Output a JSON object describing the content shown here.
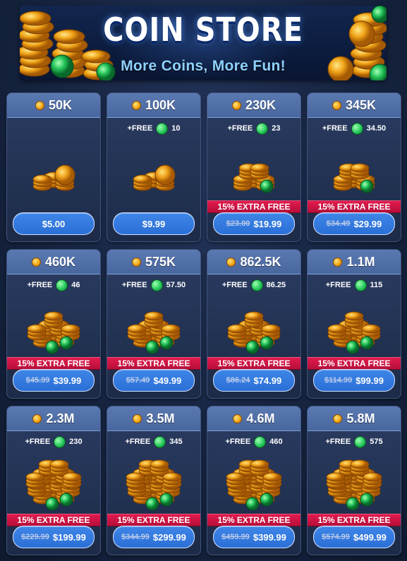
{
  "banner": {
    "title": "COIN STORE",
    "subtitle": "More Coins, More Fun!"
  },
  "free_label": "+FREE",
  "ribbon_text": "15% EXTRA FREE",
  "colors": {
    "background": "#162440",
    "card_header": "#4f6da5",
    "buy_button": "#2f76dd",
    "ribbon": "#d0164a",
    "gold": "#f2a81a",
    "gem": "#26c85c"
  },
  "icons": {
    "coin": "gold-coin-icon",
    "gem": "green-gem-icon"
  },
  "packs": [
    {
      "amount": "50K",
      "free": "",
      "ribbon": false,
      "old_price": "",
      "price": "$5.00",
      "art": 1
    },
    {
      "amount": "100K",
      "free": "10",
      "ribbon": false,
      "old_price": "",
      "price": "$9.99",
      "art": 1
    },
    {
      "amount": "230K",
      "free": "23",
      "ribbon": true,
      "old_price": "$23.00",
      "price": "$19.99",
      "art": 2
    },
    {
      "amount": "345K",
      "free": "34.50",
      "ribbon": true,
      "old_price": "$34.49",
      "price": "$29.99",
      "art": 2
    },
    {
      "amount": "460K",
      "free": "46",
      "ribbon": true,
      "old_price": "$45.99",
      "price": "$39.99",
      "art": 3
    },
    {
      "amount": "575K",
      "free": "57.50",
      "ribbon": true,
      "old_price": "$57.49",
      "price": "$49.99",
      "art": 3
    },
    {
      "amount": "862.5K",
      "free": "86.25",
      "ribbon": true,
      "old_price": "$86.24",
      "price": "$74.99",
      "art": 3
    },
    {
      "amount": "1.1M",
      "free": "115",
      "ribbon": true,
      "old_price": "$114.99",
      "price": "$99.99",
      "art": 3
    },
    {
      "amount": "2.3M",
      "free": "230",
      "ribbon": true,
      "old_price": "$229.99",
      "price": "$199.99",
      "art": 4
    },
    {
      "amount": "3.5M",
      "free": "345",
      "ribbon": true,
      "old_price": "$344.99",
      "price": "$299.99",
      "art": 4
    },
    {
      "amount": "4.6M",
      "free": "460",
      "ribbon": true,
      "old_price": "$459.99",
      "price": "$399.99",
      "art": 4
    },
    {
      "amount": "5.8M",
      "free": "575",
      "ribbon": true,
      "old_price": "$574.99",
      "price": "$499.99",
      "art": 4
    }
  ]
}
